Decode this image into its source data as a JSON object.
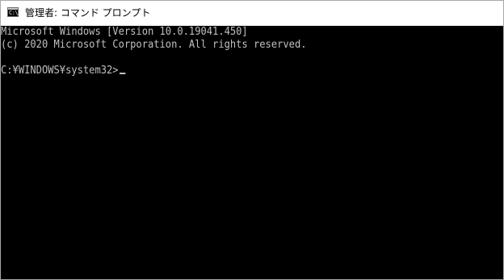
{
  "window": {
    "title": "管理者: コマンド プロンプト",
    "icon": "command-prompt-icon",
    "icon_glyph": "C:\\"
  },
  "console": {
    "lines": [
      "Microsoft Windows [Version 10.0.19041.450]",
      "(c) 2020 Microsoft Corporation. All rights reserved.",
      "C:¥WINDOWS¥system32>"
    ],
    "text_color": "#c0c0c0",
    "background_color": "#000000"
  }
}
